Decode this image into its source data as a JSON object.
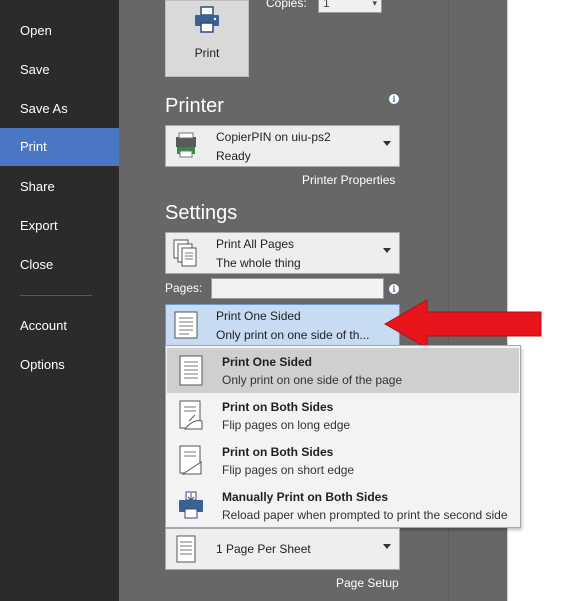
{
  "nav": {
    "items": [
      {
        "label": "Open"
      },
      {
        "label": "Save"
      },
      {
        "label": "Save As"
      },
      {
        "label": "Print"
      },
      {
        "label": "Share"
      },
      {
        "label": "Export"
      },
      {
        "label": "Close"
      },
      {
        "label": "Account"
      },
      {
        "label": "Options"
      }
    ],
    "active": "Print"
  },
  "print_button": {
    "label": "Print"
  },
  "copies": {
    "label": "Copies:",
    "value": "1"
  },
  "printer": {
    "title": "Printer",
    "name": "CopierPIN on uiu-ps2",
    "status": "Ready",
    "properties_link": "Printer Properties"
  },
  "settings": {
    "title": "Settings",
    "range": {
      "line1": "Print All Pages",
      "line2": "The whole thing"
    },
    "pages_label": "Pages:",
    "pages_value": "",
    "sided": {
      "line1": "Print One Sided",
      "line2": "Only print on one side of th..."
    },
    "sheet": {
      "line1": "1 Page Per Sheet"
    },
    "page_setup_link": "Page Setup"
  },
  "sided_options": [
    {
      "title": "Print One Sided",
      "sub": "Only print on one side of the page",
      "icon": "one-sided-icon"
    },
    {
      "title": "Print on Both Sides",
      "sub": "Flip pages on long edge",
      "icon": "long-edge-icon"
    },
    {
      "title": "Print on Both Sides",
      "sub": "Flip pages on short edge",
      "icon": "short-edge-icon"
    },
    {
      "title": "Manually Print on Both Sides",
      "sub": "Reload paper when prompted to print the second side",
      "icon": "manual-duplex-icon"
    }
  ],
  "colors": {
    "nav_bg": "#2b2b2b",
    "nav_active": "#4a76c4",
    "panel_bg": "#676767",
    "selected_dropdown": "#c7dbf3",
    "annotation_arrow": "#e8141b"
  }
}
